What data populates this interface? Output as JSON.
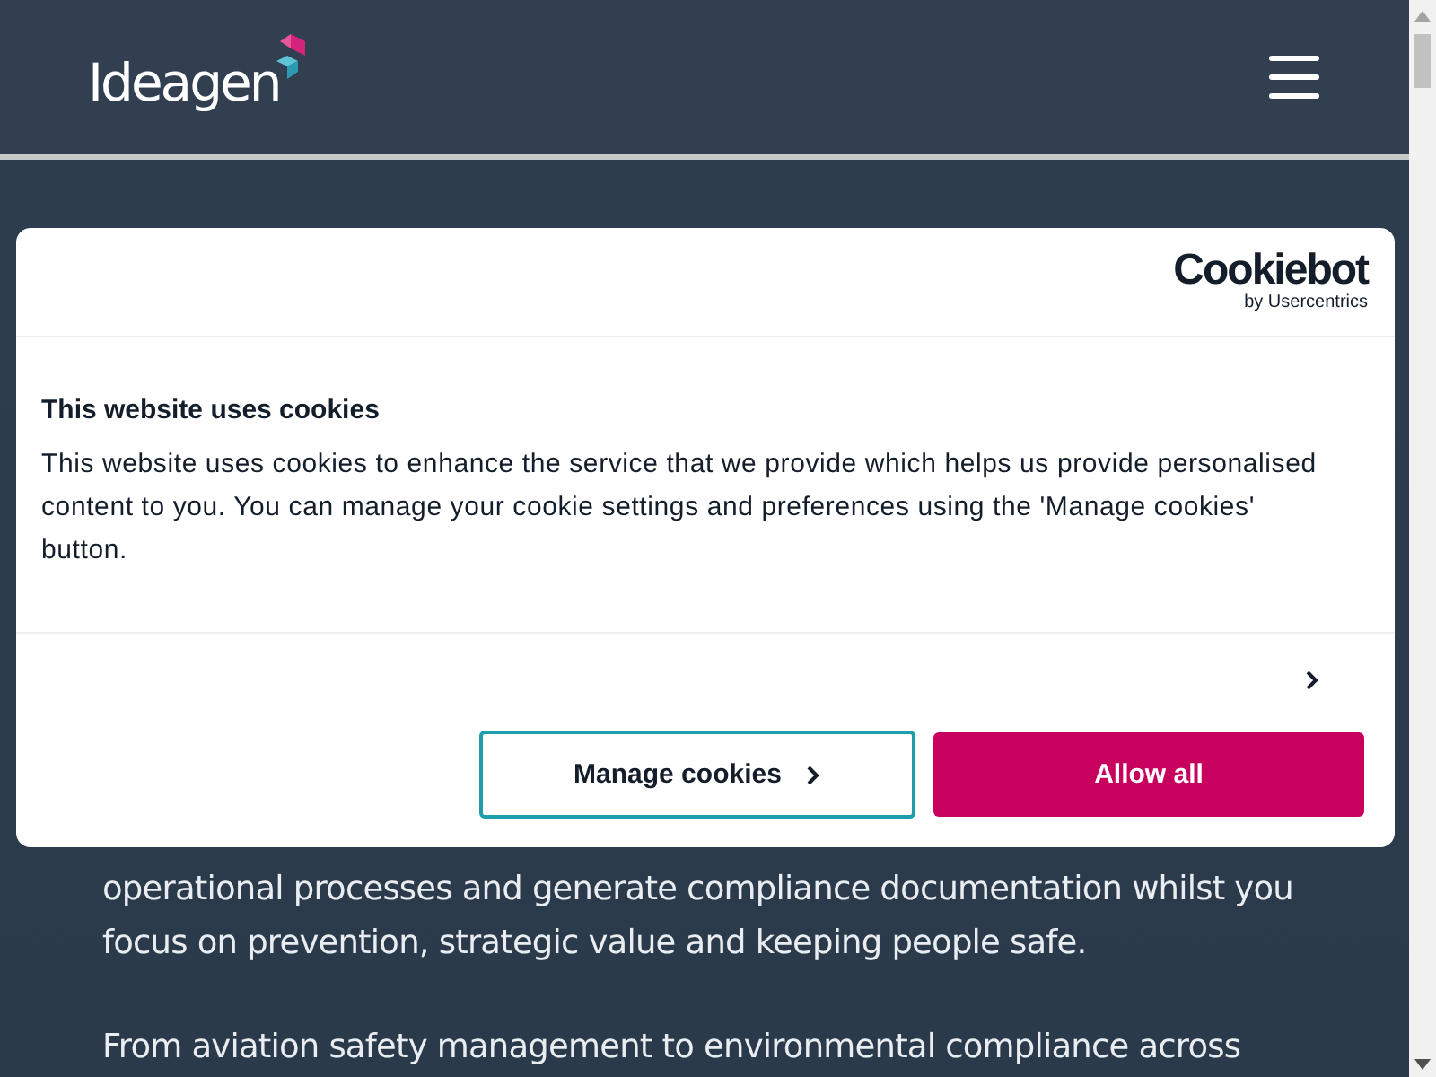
{
  "header": {
    "logo": "Ideagen"
  },
  "body_paragraphs": [
    "operational processes and generate compliance documentation whilst you focus on prevention, strategic value and keeping people safe.",
    "From aviation safety management to environmental compliance across"
  ],
  "cookie_dialog": {
    "brand": "Cookiebot",
    "brand_sub": "by Usercentrics",
    "title": "This website uses cookies",
    "text": "This website uses cookies to enhance the service that we provide which helps us provide personalised content to you. You can manage your cookie settings and preferences using the 'Manage cookies' button.",
    "buttons": [
      {
        "label": "Manage cookies",
        "kind": "outline"
      },
      {
        "label": "Allow all",
        "kind": "primary"
      }
    ]
  }
}
